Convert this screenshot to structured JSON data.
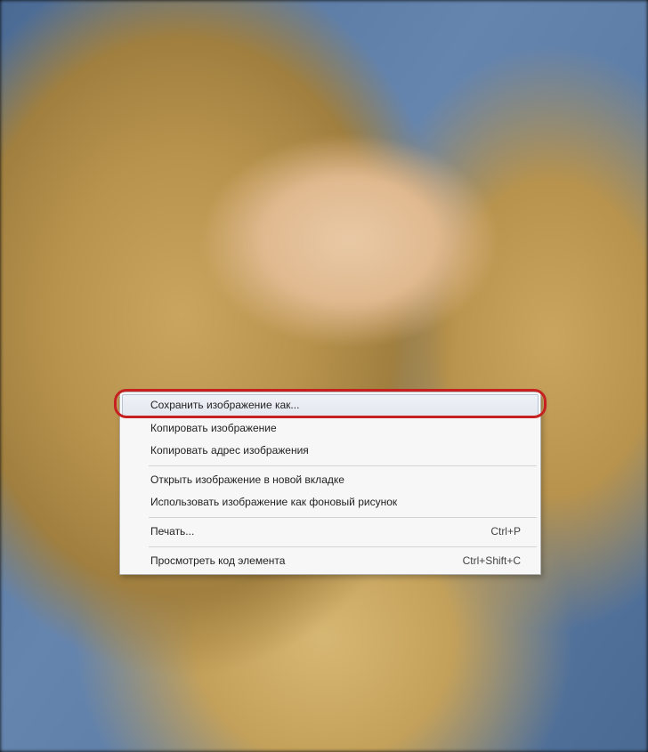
{
  "context_menu": {
    "items": [
      {
        "label": "Сохранить изображение как...",
        "shortcut": "",
        "highlighted": true
      },
      {
        "label": "Копировать изображение",
        "shortcut": ""
      },
      {
        "label": "Копировать адрес изображения",
        "shortcut": ""
      },
      {
        "separator": true
      },
      {
        "label": "Открыть изображение в новой вкладке",
        "shortcut": ""
      },
      {
        "label": "Использовать изображение как фоновый рисунок",
        "shortcut": ""
      },
      {
        "separator": true
      },
      {
        "label": "Печать...",
        "shortcut": "Ctrl+P"
      },
      {
        "separator": true
      },
      {
        "label": "Просмотреть код элемента",
        "shortcut": "Ctrl+Shift+C"
      }
    ]
  }
}
